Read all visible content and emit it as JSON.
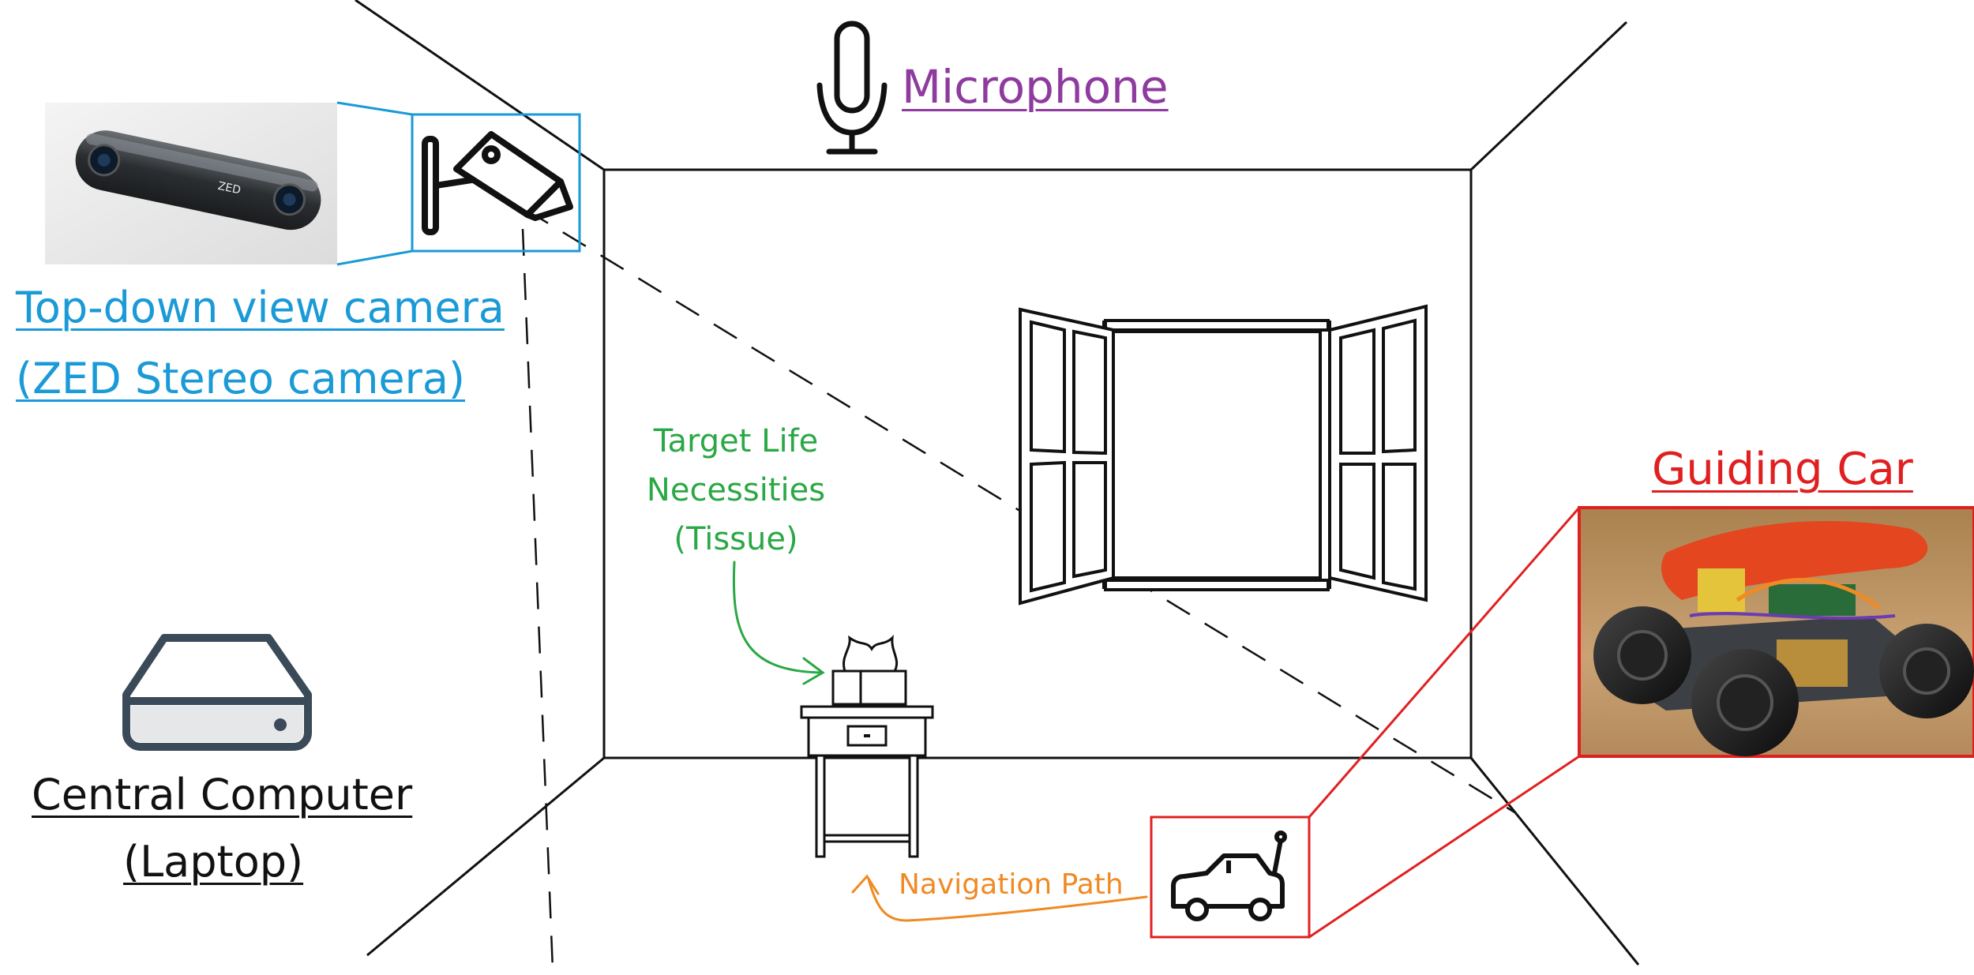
{
  "colors": {
    "line": "#111111",
    "camera": "#1a9ad6",
    "microphone": "#8e3a9e",
    "target": "#2aa845",
    "navigation": "#f08a24",
    "car": "#e02020",
    "computer": "#111111"
  },
  "labels": {
    "camera_line1": "Top-down view camera",
    "camera_line2": "(ZED Stereo camera)",
    "microphone": "Microphone",
    "computer_line1": "Central Computer",
    "computer_line2": "(Laptop)",
    "car": "Guiding Car",
    "target_line1": "Target Life",
    "target_line2": "Necessities",
    "target_line3": "(Tissue)",
    "navigation": "Navigation Path"
  },
  "photos": {
    "camera_brand": "ZED"
  },
  "icons": {
    "camera": "cctv-camera-icon",
    "microphone": "microphone-icon",
    "computer": "mini-computer-icon",
    "car": "toy-car-icon",
    "window": "open-window",
    "table": "side-table",
    "tissue": "tissue-box"
  }
}
